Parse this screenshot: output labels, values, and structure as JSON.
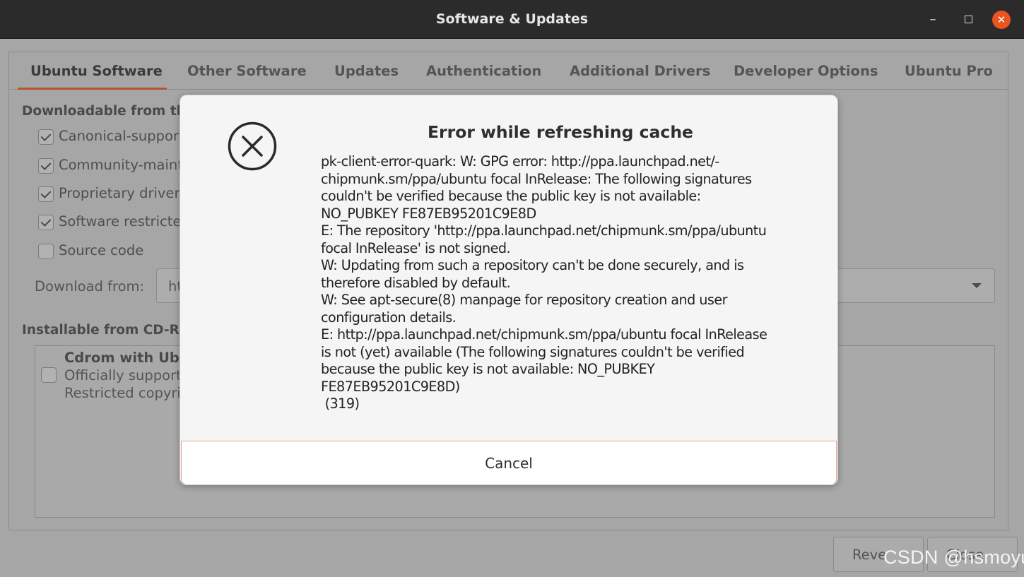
{
  "window": {
    "title": "Software & Updates",
    "min_glyph": "–",
    "close_glyph": "✕"
  },
  "tabs": [
    {
      "label": "Ubuntu Software"
    },
    {
      "label": "Other Software"
    },
    {
      "label": "Updates"
    },
    {
      "label": "Authentication"
    },
    {
      "label": "Additional Drivers"
    },
    {
      "label": "Developer Options"
    },
    {
      "label": "Ubuntu Pro"
    }
  ],
  "background": {
    "downloadable_heading": "Downloadable from th",
    "options": [
      {
        "label": "Canonical-support",
        "checked": true
      },
      {
        "label": "Community-maint",
        "checked": true
      },
      {
        "label": "Proprietary driver",
        "checked": true
      },
      {
        "label": "Software restricte",
        "checked": true
      },
      {
        "label": "Source code",
        "checked": false
      }
    ],
    "download_from_label": "Download from:",
    "download_from_value": "ht",
    "installable_heading": "Installable from CD-R",
    "cdrom": {
      "title": "Cdrom with Ubu",
      "line2": "Officially support",
      "line3": "Restricted copyri"
    },
    "revert_label": "Reve",
    "close_label": "Close"
  },
  "dialog": {
    "icon": "error-circle-x-icon",
    "title": "Error while refreshing cache",
    "message": "pk-client-error-quark: W: GPG error: http://ppa.launchpad.net/-\nchipmunk.sm/ppa/ubuntu focal InRelease: The following signatures\ncouldn't be verified because the public key is not available:\nNO_PUBKEY FE87EB95201C9E8D\nE: The repository 'http://ppa.launchpad.net/chipmunk.sm/ppa/ubuntu\nfocal InRelease' is not signed.\nW: Updating from such a repository can't be done securely, and is\ntherefore disabled by default.\nW: See apt-secure(8) manpage for repository creation and user\nconfiguration details.\nE: http://ppa.launchpad.net/chipmunk.sm/ppa/ubuntu focal InRelease\nis not (yet) available (The following signatures couldn't be verified\nbecause the public key is not available: NO_PUBKEY\nFE87EB95201C9E8D)\n (319)",
    "cancel_label": "Cancel"
  },
  "watermark": "CSDN @hsmoyu",
  "colors": {
    "accent": "#e95420",
    "titlebar": "#2b2b2b",
    "tab_underline": "#b8542d"
  }
}
